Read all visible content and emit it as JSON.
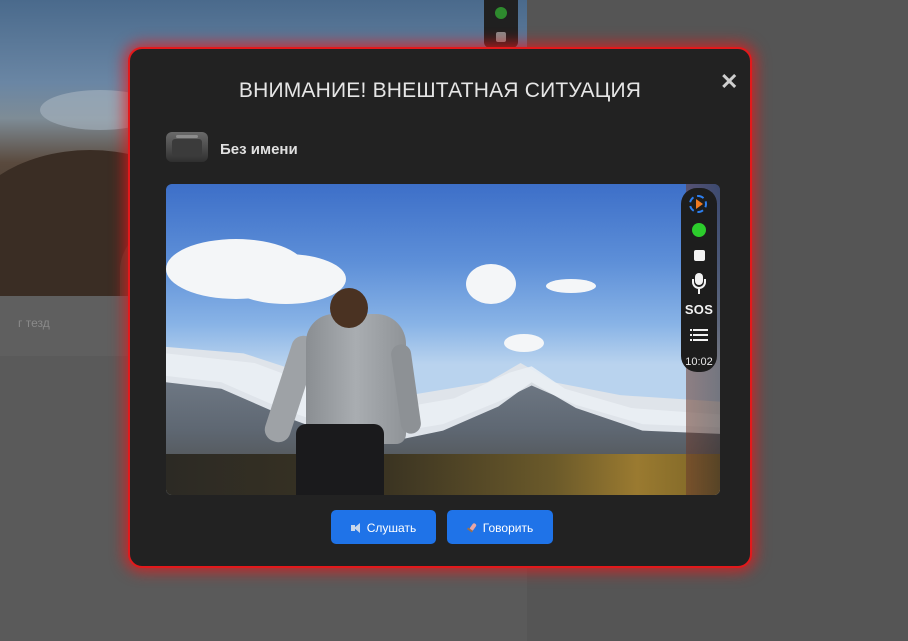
{
  "background": {
    "caption": "г тезд"
  },
  "modal": {
    "title": "ВНИМАНИЕ! ВНЕШТАТНАЯ СИТУАЦИЯ",
    "close_symbol": "✕",
    "device_name": "Без имени",
    "accent_color": "#e3191b"
  },
  "video_controls": {
    "play_icon": "play-circle-icon",
    "status_color": "#2ccc2c",
    "stop_icon": "stop-icon",
    "mic_icon": "microphone-icon",
    "sos_label": "SOS",
    "list_icon": "list-icon",
    "time": "10:02"
  },
  "actions": {
    "listen_label": "Слушать",
    "talk_label": "Говорить",
    "button_color": "#1f73e8"
  }
}
